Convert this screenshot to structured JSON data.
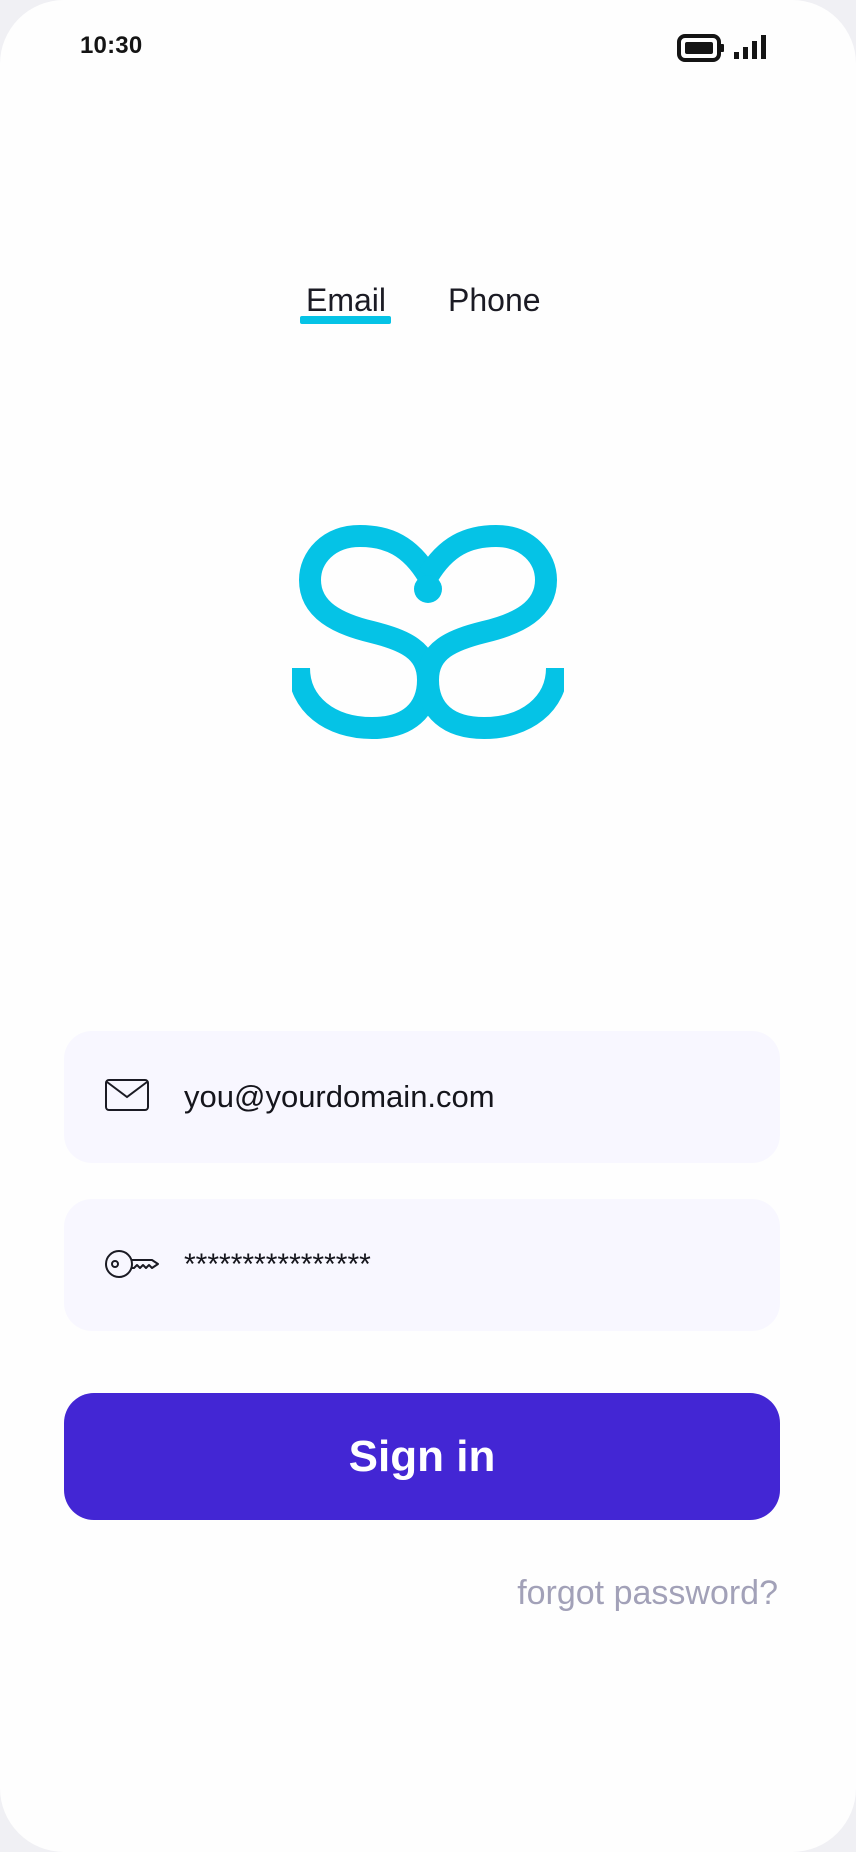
{
  "status_bar": {
    "time": "10:30"
  },
  "tabs": [
    {
      "label": "Email",
      "active": true
    },
    {
      "label": "Phone",
      "active": false
    }
  ],
  "logo": {
    "icon": "heart-logo-icon",
    "color": "#05c3e6"
  },
  "form": {
    "email": {
      "icon": "envelope-icon",
      "value": "you@yourdomain.com"
    },
    "password": {
      "icon": "key-icon",
      "value": "****************"
    },
    "submit_label": "Sign in",
    "forgot_label": "forgot password?"
  },
  "colors": {
    "accent": "#05c3e6",
    "primary_button": "#4326d4",
    "field_background": "#f8f7ff",
    "muted_text": "#a2a1b8"
  }
}
